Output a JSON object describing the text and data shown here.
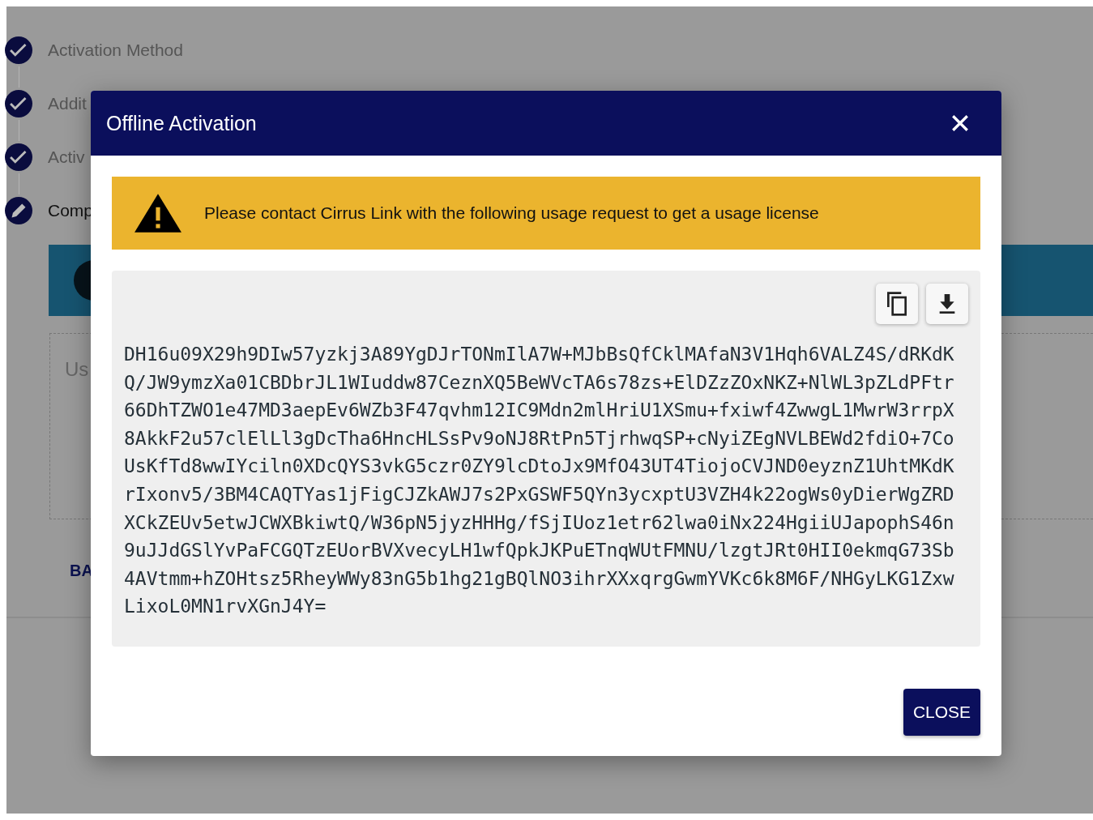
{
  "background": {
    "steps": [
      {
        "label": "Activation Method",
        "kind": "done"
      },
      {
        "label": "Addit",
        "kind": "done"
      },
      {
        "label": "Activ",
        "kind": "done"
      },
      {
        "label": "Comp",
        "kind": "editing"
      }
    ],
    "field": {
      "label": "Us"
    },
    "back_button": "BA"
  },
  "dialog": {
    "title": "Offline Activation",
    "alert": "Please contact Cirrus Link with the following usage request to get a usage license",
    "request_lines": [
      "DH16u09X29h9DIw57yzkj3A89YgDJrTONmIlA7W+MJbBsQfCklMAfaN3V1Hqh6VALZ4S/dRKdK",
      "Q/JW9ymzXa01CBDbrJL1WIuddw87CeznXQ5BeWVcTA6s78zs+ElDZzZOxNKZ+NlWL3pZLdPFtr",
      "66DhTZWO1e47MD3aepEv6WZb3F47qvhm12IC9Mdn2mlHriU1XSmu+fxiwf4ZwwgL1MwrW3rrpX",
      "8AkkF2u57clElLl3gDcTha6HncHLSsPv9oNJ8RtPn5TjrhwqSP+cNyiZEgNVLBEWd2fdiO+7Co",
      "UsKfTd8wwIYciln0XDcQYS3vkG5czr0ZY9lcDtoJx9MfO43UT4TiojoCVJND0eyznZ1UhtMKdK",
      "rIxonv5/3BM4CAQTYas1jFigCJZkAWJ7s2PxGSWF5QYn3ycxptU3VZH4k22ogWs0yDierWgZRD",
      "XCkZEUv5etwJCWXBkiwtQ/W36pN5jyzHHHg/fSjIUoz1etr62lwa0iNx224HgiiUJapophS46n",
      "9uJJdGSlYvPaFCGQTzEUorBVXvecyLH1wfQpkJKPuETnqWUtFMNU/lzgtJRt0HII0ekmqG73Sb",
      "4AVtmm+hZOHtsz5RheyWWy83nG5b1hg21gBQlNO3ihrXXxqrgGwmYVKc6k8M6F/NHGyLKG1Zxw",
      "LixoL0MN1rvXGnJ4Y="
    ],
    "close_button": "CLOSE"
  }
}
